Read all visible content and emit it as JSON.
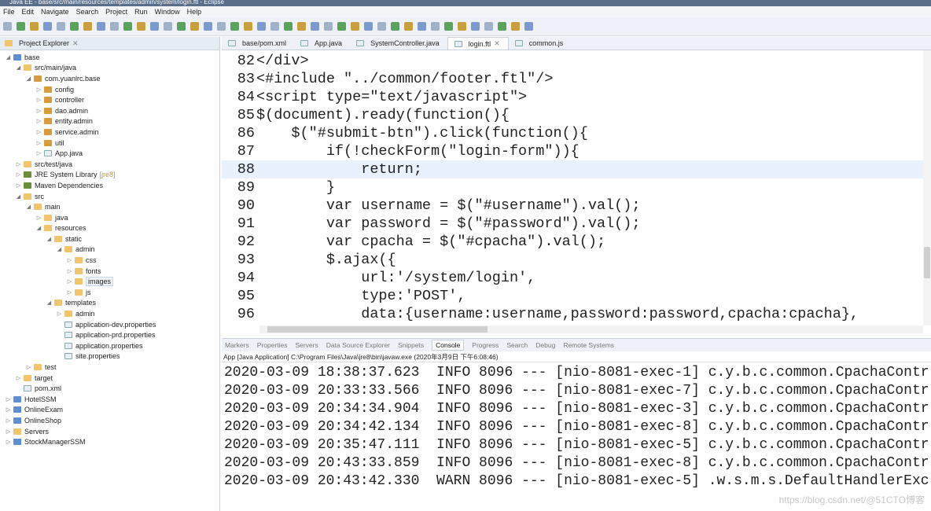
{
  "window_title": "Java EE - base/src/main/resources/templates/admin/system/login.ftl - Eclipse",
  "menu": [
    "File",
    "Edit",
    "Navigate",
    "Search",
    "Project",
    "Run",
    "Window",
    "Help"
  ],
  "project_explorer": {
    "title": "Project Explorer",
    "items": [
      {
        "label": "base",
        "level": 0,
        "icon": "project",
        "exp": "open"
      },
      {
        "label": "src/main/java",
        "level": 1,
        "icon": "folder",
        "exp": "open"
      },
      {
        "label": "com.yuanlrc.base",
        "level": 2,
        "icon": "package",
        "exp": "open"
      },
      {
        "label": "config",
        "level": 3,
        "icon": "package",
        "exp": "closed"
      },
      {
        "label": "controller",
        "level": 3,
        "icon": "package",
        "exp": "closed"
      },
      {
        "label": "dao.admin",
        "level": 3,
        "icon": "package",
        "exp": "closed"
      },
      {
        "label": "entity.admin",
        "level": 3,
        "icon": "package",
        "exp": "closed"
      },
      {
        "label": "service.admin",
        "level": 3,
        "icon": "package",
        "exp": "closed"
      },
      {
        "label": "util",
        "level": 3,
        "icon": "package",
        "exp": "closed"
      },
      {
        "label": "App.java",
        "level": 3,
        "icon": "file",
        "exp": "closed"
      },
      {
        "label": "src/test/java",
        "level": 1,
        "icon": "folder",
        "exp": "closed"
      },
      {
        "label": "JRE System Library",
        "deco": "[jre8]",
        "level": 1,
        "icon": "library",
        "exp": "closed"
      },
      {
        "label": "Maven Dependencies",
        "level": 1,
        "icon": "library",
        "exp": "closed"
      },
      {
        "label": "src",
        "level": 1,
        "icon": "folder",
        "exp": "open"
      },
      {
        "label": "main",
        "level": 2,
        "icon": "folder",
        "exp": "open"
      },
      {
        "label": "java",
        "level": 3,
        "icon": "folder",
        "exp": "closed"
      },
      {
        "label": "resources",
        "level": 3,
        "icon": "folder",
        "exp": "open"
      },
      {
        "label": "static",
        "level": 4,
        "icon": "folder",
        "exp": "open"
      },
      {
        "label": "admin",
        "level": 5,
        "icon": "folder",
        "exp": "open"
      },
      {
        "label": "css",
        "level": 6,
        "icon": "folder",
        "exp": "closed"
      },
      {
        "label": "fonts",
        "level": 6,
        "icon": "folder",
        "exp": "closed"
      },
      {
        "label": "images",
        "level": 6,
        "icon": "folder",
        "exp": "closed",
        "selected": true
      },
      {
        "label": "js",
        "level": 6,
        "icon": "folder",
        "exp": "closed"
      },
      {
        "label": "templates",
        "level": 4,
        "icon": "folder",
        "exp": "open"
      },
      {
        "label": "admin",
        "level": 5,
        "icon": "folder",
        "exp": "closed"
      },
      {
        "label": "application-dev.properties",
        "level": 5,
        "icon": "file",
        "exp": "none"
      },
      {
        "label": "application-prd.properties",
        "level": 5,
        "icon": "file",
        "exp": "none"
      },
      {
        "label": "application.properties",
        "level": 5,
        "icon": "file",
        "exp": "none"
      },
      {
        "label": "site.properties",
        "level": 5,
        "icon": "file",
        "exp": "none"
      },
      {
        "label": "test",
        "level": 2,
        "icon": "folder",
        "exp": "closed"
      },
      {
        "label": "target",
        "level": 1,
        "icon": "folder",
        "exp": "closed"
      },
      {
        "label": "pom.xml",
        "level": 1,
        "icon": "file",
        "exp": "none"
      },
      {
        "label": "HotelSSM",
        "level": 0,
        "icon": "project",
        "exp": "closed"
      },
      {
        "label": "OnlineExam",
        "level": 0,
        "icon": "project",
        "exp": "closed"
      },
      {
        "label": "OnlineShop",
        "level": 0,
        "icon": "project",
        "exp": "closed"
      },
      {
        "label": "Servers",
        "level": 0,
        "icon": "folder",
        "exp": "closed"
      },
      {
        "label": "StockManagerSSM",
        "level": 0,
        "icon": "project",
        "exp": "closed"
      }
    ]
  },
  "editor_tabs": [
    {
      "label": "base/pom.xml"
    },
    {
      "label": "App.java"
    },
    {
      "label": "SystemController.java"
    },
    {
      "label": "login.ftl",
      "active": true
    },
    {
      "label": "common.js"
    }
  ],
  "code_lines": [
    {
      "n": "82",
      "text": "</div>"
    },
    {
      "n": "83",
      "text": "<#include \"../common/footer.ftl\"/>"
    },
    {
      "n": "84",
      "text": "<script type=\"text/javascript\">"
    },
    {
      "n": "85",
      "text": "$(document).ready(function(){"
    },
    {
      "n": "86",
      "text": "    $(\"#submit-btn\").click(function(){"
    },
    {
      "n": "87",
      "text": "        if(!checkForm(\"login-form\")){"
    },
    {
      "n": "88",
      "text": "            return;",
      "current": true
    },
    {
      "n": "89",
      "text": "        }"
    },
    {
      "n": "90",
      "text": "        var username = $(\"#username\").val();"
    },
    {
      "n": "91",
      "text": "        var password = $(\"#password\").val();"
    },
    {
      "n": "92",
      "text": "        var cpacha = $(\"#cpacha\").val();"
    },
    {
      "n": "93",
      "text": "        $.ajax({"
    },
    {
      "n": "94",
      "text": "            url:'/system/login',"
    },
    {
      "n": "95",
      "text": "            type:'POST',"
    },
    {
      "n": "96",
      "text": "            data:{username:username,password:password,cpacha:cpacha},"
    }
  ],
  "bottom_tabs": [
    {
      "label": "Markers"
    },
    {
      "label": "Properties"
    },
    {
      "label": "Servers"
    },
    {
      "label": "Data Source Explorer"
    },
    {
      "label": "Snippets"
    },
    {
      "label": "Console",
      "active": true
    },
    {
      "label": "Progress"
    },
    {
      "label": "Search"
    },
    {
      "label": "Debug"
    },
    {
      "label": "Remote Systems"
    }
  ],
  "console": {
    "header": "App [Java Application] C:\\Program Files\\Java\\jre8\\bin\\javaw.exe (2020年3月9日 下午6:08:46)",
    "lines": [
      "2020-03-09 18:38:37.623  INFO 8096 --- [nio-8081-exec-1] c.y.b.c.common.CpachaContr",
      "2020-03-09 20:33:33.566  INFO 8096 --- [nio-8081-exec-7] c.y.b.c.common.CpachaContr",
      "2020-03-09 20:34:34.904  INFO 8096 --- [nio-8081-exec-3] c.y.b.c.common.CpachaContr",
      "2020-03-09 20:34:42.134  INFO 8096 --- [nio-8081-exec-8] c.y.b.c.common.CpachaContr",
      "2020-03-09 20:35:47.111  INFO 8096 --- [nio-8081-exec-5] c.y.b.c.common.CpachaContr",
      "2020-03-09 20:43:33.859  INFO 8096 --- [nio-8081-exec-8] c.y.b.c.common.CpachaContr",
      "2020-03-09 20:43:42.330  WARN 8096 --- [nio-8081-exec-5] .w.s.m.s.DefaultHandlerExc"
    ]
  },
  "watermark": "https://blog.csdn.net/@51CTO博客"
}
